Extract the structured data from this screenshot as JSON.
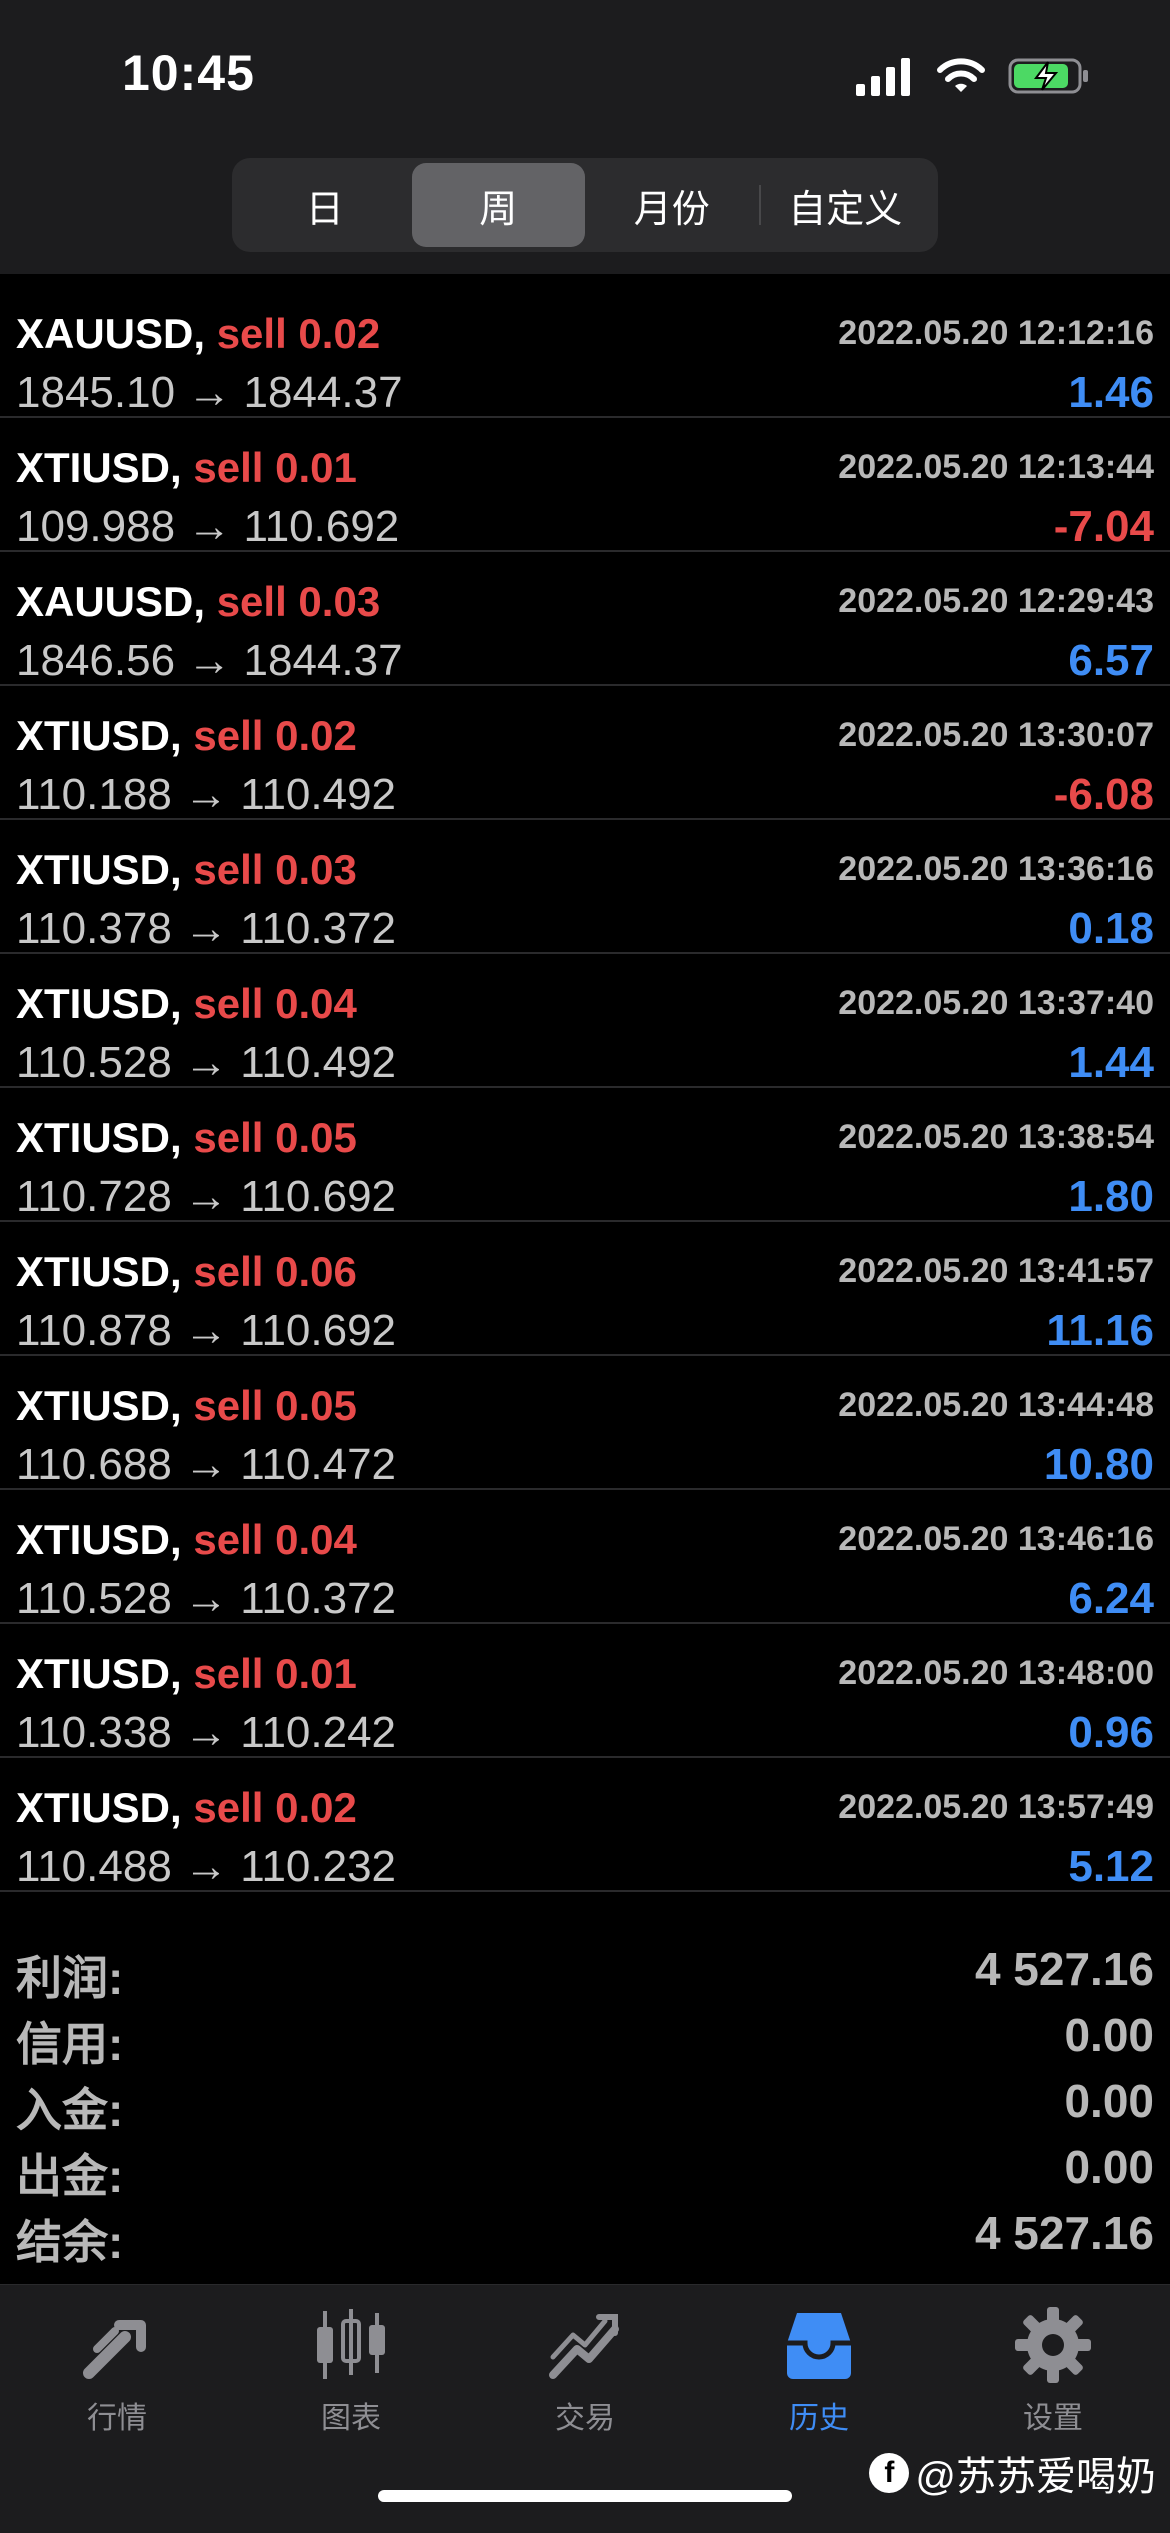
{
  "status_bar": {
    "time": "10:45"
  },
  "segments": [
    {
      "label": "日",
      "active": false
    },
    {
      "label": "周",
      "active": true
    },
    {
      "label": "月份",
      "active": false
    },
    {
      "label": "自定义",
      "active": false
    }
  ],
  "deals": [
    {
      "symbol": "XAUUSD,",
      "direction": "sell 0.02",
      "date": "2022.05.20 12:12:16",
      "price": "1845.10 → 1844.37",
      "profit": "1.46",
      "profit_sign": "pos"
    },
    {
      "symbol": "XTIUSD,",
      "direction": "sell 0.01",
      "date": "2022.05.20 12:13:44",
      "price": "109.988 → 110.692",
      "profit": "-7.04",
      "profit_sign": "neg"
    },
    {
      "symbol": "XAUUSD,",
      "direction": "sell 0.03",
      "date": "2022.05.20 12:29:43",
      "price": "1846.56 → 1844.37",
      "profit": "6.57",
      "profit_sign": "pos"
    },
    {
      "symbol": "XTIUSD,",
      "direction": "sell 0.02",
      "date": "2022.05.20 13:30:07",
      "price": "110.188 → 110.492",
      "profit": "-6.08",
      "profit_sign": "neg"
    },
    {
      "symbol": "XTIUSD,",
      "direction": "sell 0.03",
      "date": "2022.05.20 13:36:16",
      "price": "110.378 → 110.372",
      "profit": "0.18",
      "profit_sign": "pos"
    },
    {
      "symbol": "XTIUSD,",
      "direction": "sell 0.04",
      "date": "2022.05.20 13:37:40",
      "price": "110.528 → 110.492",
      "profit": "1.44",
      "profit_sign": "pos"
    },
    {
      "symbol": "XTIUSD,",
      "direction": "sell 0.05",
      "date": "2022.05.20 13:38:54",
      "price": "110.728 → 110.692",
      "profit": "1.80",
      "profit_sign": "pos"
    },
    {
      "symbol": "XTIUSD,",
      "direction": "sell 0.06",
      "date": "2022.05.20 13:41:57",
      "price": "110.878 → 110.692",
      "profit": "11.16",
      "profit_sign": "pos"
    },
    {
      "symbol": "XTIUSD,",
      "direction": "sell 0.05",
      "date": "2022.05.20 13:44:48",
      "price": "110.688 → 110.472",
      "profit": "10.80",
      "profit_sign": "pos"
    },
    {
      "symbol": "XTIUSD,",
      "direction": "sell 0.04",
      "date": "2022.05.20 13:46:16",
      "price": "110.528 → 110.372",
      "profit": "6.24",
      "profit_sign": "pos"
    },
    {
      "symbol": "XTIUSD,",
      "direction": "sell 0.01",
      "date": "2022.05.20 13:48:00",
      "price": "110.338 → 110.242",
      "profit": "0.96",
      "profit_sign": "pos"
    },
    {
      "symbol": "XTIUSD,",
      "direction": "sell 0.02",
      "date": "2022.05.20 13:57:49",
      "price": "110.488 → 110.232",
      "profit": "5.12",
      "profit_sign": "pos"
    }
  ],
  "summary": [
    {
      "label": "利润:",
      "value": "4 527.16"
    },
    {
      "label": "信用:",
      "value": "0.00"
    },
    {
      "label": "入金:",
      "value": "0.00"
    },
    {
      "label": "出金:",
      "value": "0.00"
    },
    {
      "label": "结余:",
      "value": "4 527.16"
    }
  ],
  "tabs": [
    {
      "label": "行情",
      "icon": "quotes-icon",
      "active": false
    },
    {
      "label": "图表",
      "icon": "chart-icon",
      "active": false
    },
    {
      "label": "交易",
      "icon": "trade-icon",
      "active": false
    },
    {
      "label": "历史",
      "icon": "history-icon",
      "active": true
    },
    {
      "label": "设置",
      "icon": "settings-icon",
      "active": false
    }
  ],
  "watermark": "@苏苏爱喝奶",
  "colors": {
    "positive": "#3f8df5",
    "negative": "#e84a4a",
    "active_tab": "#3f8df5"
  }
}
